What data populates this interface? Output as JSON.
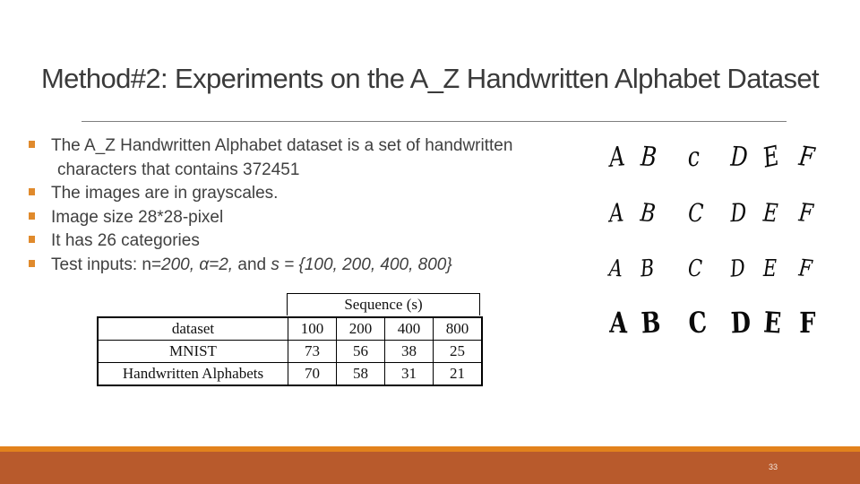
{
  "slide": {
    "title": "Method#2: Experiments on the A_Z Handwritten Alphabet Dataset",
    "page_number": "33"
  },
  "bullets": [
    {
      "text": "The A_Z Handwritten Alphabet dataset is a set of handwritten",
      "continuation": "characters that contains 372451"
    },
    {
      "text": "The images are in grayscales."
    },
    {
      "text": "Image size 28*28-pixel"
    },
    {
      "text": "It has 26 categories"
    },
    {
      "parts": {
        "prefix": "Test inputs: n=",
        "n": "200,",
        "mid1": " ",
        "alpha": "α=2,",
        "mid2": " and ",
        "s": "s = {100, 200, 400, 800}"
      }
    }
  ],
  "table": {
    "group_header": "Sequence (s)",
    "columns": [
      "dataset",
      "100",
      "200",
      "400",
      "800"
    ],
    "rows": [
      {
        "dataset": "MNIST",
        "values": [
          "73",
          "56",
          "38",
          "25"
        ]
      },
      {
        "dataset": "Handwritten Alphabets",
        "values": [
          "70",
          "58",
          "31",
          "21"
        ]
      }
    ]
  },
  "sample_images": {
    "description": "handwritten letter samples",
    "rows": [
      [
        "A",
        "B",
        "c",
        "D",
        "E",
        "F"
      ],
      [
        "A",
        "B",
        "C",
        "D",
        "E",
        "F"
      ],
      [
        "A",
        "B",
        "C",
        "D",
        "E",
        "F"
      ],
      [
        "A",
        "B",
        "C",
        "D",
        "E",
        "F"
      ]
    ]
  },
  "colors": {
    "bullet": "#e08a2c",
    "footer_stripe": "#e2821c",
    "footer": "#b85a2c"
  }
}
